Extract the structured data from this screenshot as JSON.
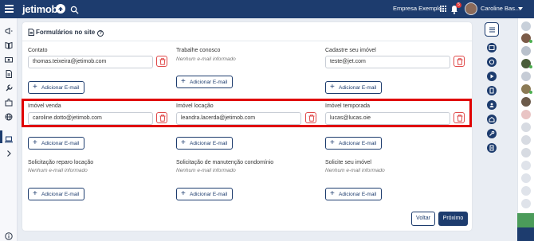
{
  "app": {
    "logo_text": "jetimob",
    "company": "Empresa Exemplo",
    "notification_count": "5",
    "user_name": "Caroline Bas..."
  },
  "section": {
    "title": "Formulários no site",
    "help": "?"
  },
  "common": {
    "add_email_label": "Adicionar E-mail",
    "empty_text": "Nenhum e-mail informado"
  },
  "forms": {
    "contato": {
      "label": "Contato",
      "email": "thomas.teixeira@jetimob.com"
    },
    "trabalhe": {
      "label": "Trabalhe conosco",
      "empty": "Nenhum e-mail informado"
    },
    "cadastre": {
      "label": "Cadastre seu imóvel",
      "email": "teste@jet.com"
    },
    "venda": {
      "label": "Imóvel venda",
      "email": "caroline.dotto@jetimob.com"
    },
    "locacao": {
      "label": "Imóvel locação",
      "email": "leandra.lacerda@jetimob.com"
    },
    "temporada": {
      "label": "Imóvel temporada",
      "email": "lucas@lucas.oie"
    },
    "reparo": {
      "label": "Solicitação reparo locação",
      "empty": "Nenhum e-mail informado"
    },
    "manutencao": {
      "label": "Solicitação de manutenção condomínio",
      "empty": "Nenhum e-mail informado"
    },
    "solicite": {
      "label": "Solicite seu imóvel",
      "empty": "Nenhum e-mail informado"
    }
  },
  "footer": {
    "back_label": "Voltar",
    "next_label": "Próximo"
  },
  "colors": {
    "navy": "#1d3c6e",
    "danger": "#e04a4a",
    "highlight": "#e00000"
  }
}
